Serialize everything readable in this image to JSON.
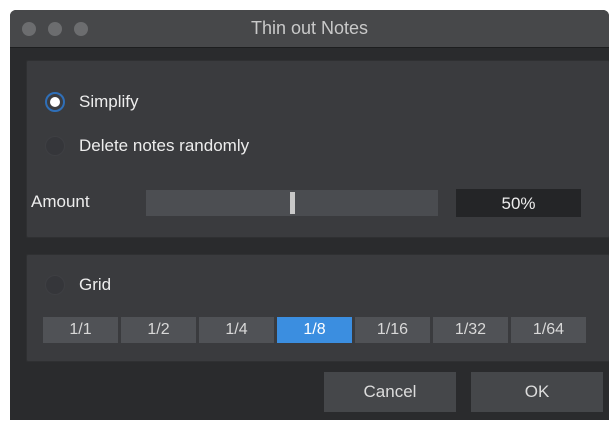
{
  "window": {
    "title": "Thin out Notes"
  },
  "mode": {
    "options": [
      {
        "label": "Simplify",
        "selected": true
      },
      {
        "label": "Delete notes randomly",
        "selected": false
      }
    ]
  },
  "amount": {
    "label": "Amount",
    "value_text": "50%",
    "value": 0.5
  },
  "grid": {
    "label": "Grid",
    "selected": false,
    "options": [
      "1/1",
      "1/2",
      "1/4",
      "1/8",
      "1/16",
      "1/32",
      "1/64"
    ],
    "selected_option": "1/8"
  },
  "buttons": {
    "cancel": "Cancel",
    "ok": "OK"
  },
  "colors": {
    "accent": "#3b8ee0",
    "radio_ring": "#2f6fb8"
  }
}
